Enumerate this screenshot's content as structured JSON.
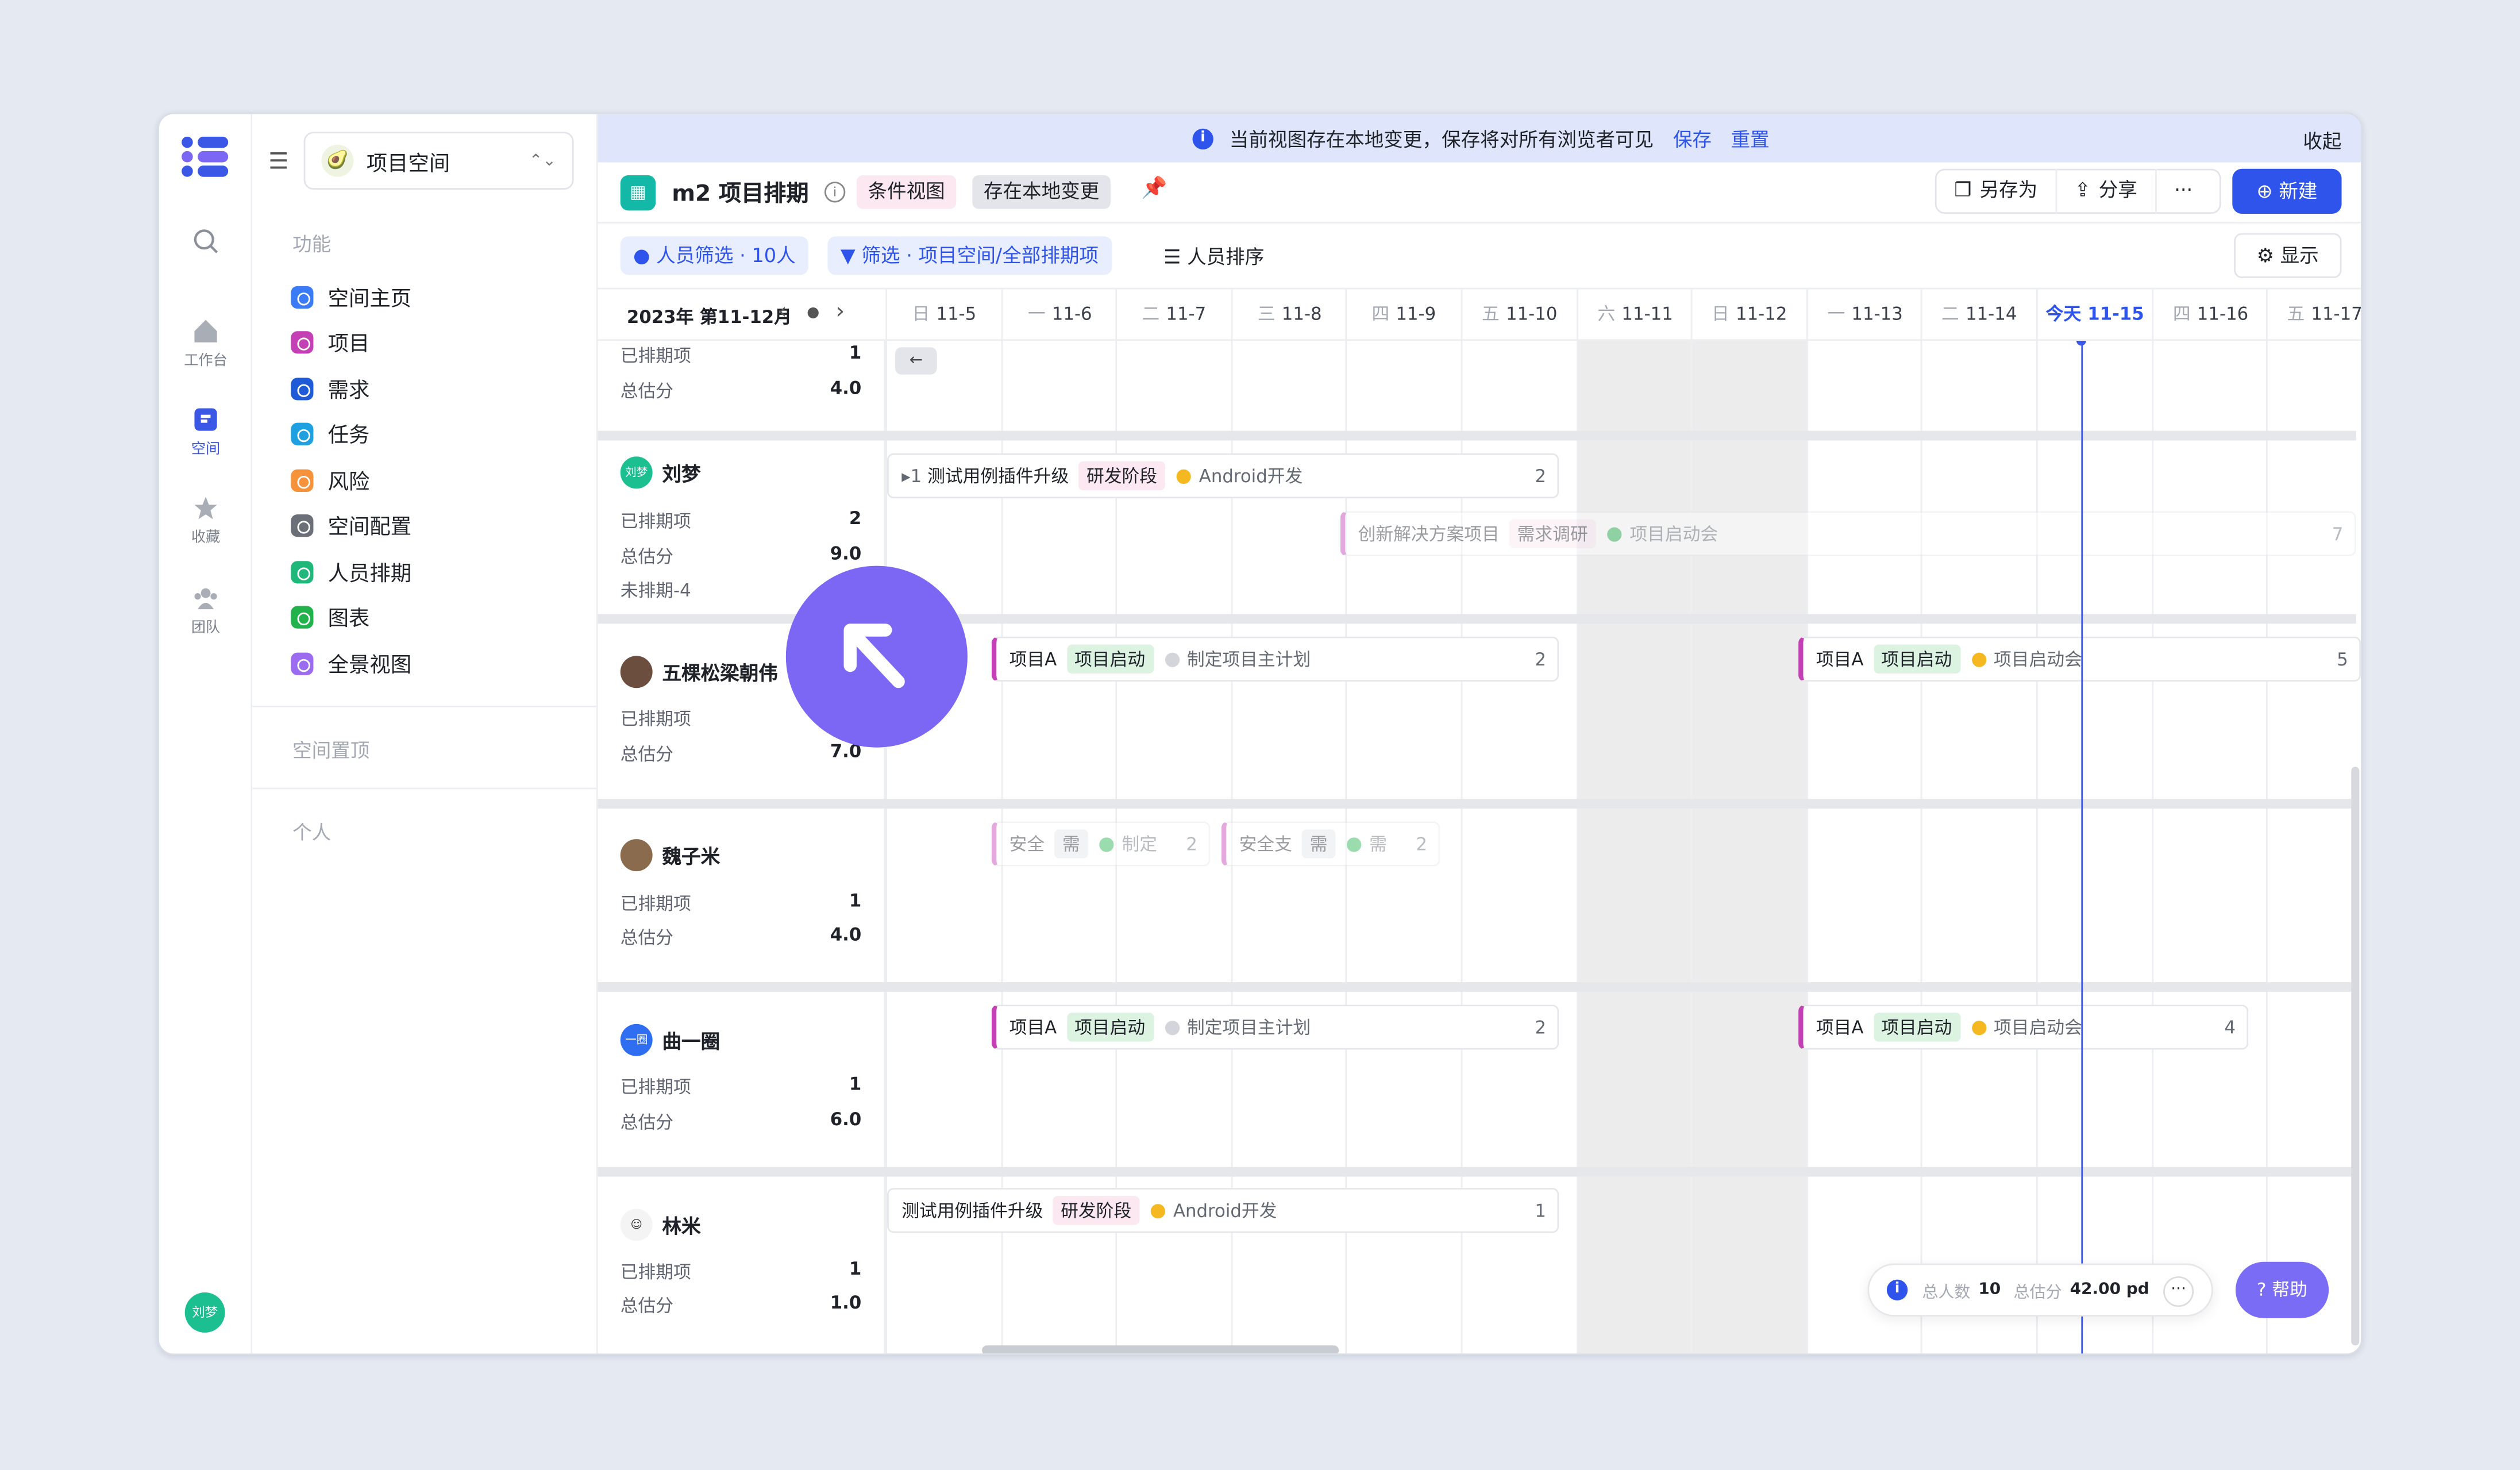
{
  "banner": {
    "text": "当前视图存在本地变更，保存将对所有浏览者可见",
    "save": "保存",
    "reset": "重置",
    "collapse": "收起"
  },
  "rail": {
    "items": [
      {
        "label": "工作台",
        "icon": "home-icon"
      },
      {
        "label": "空间",
        "icon": "space-icon"
      },
      {
        "label": "收藏",
        "icon": "star-icon"
      },
      {
        "label": "团队",
        "icon": "team-icon"
      }
    ],
    "user_avatar": "刘梦"
  },
  "sidebar": {
    "workspace": "项目空间",
    "section_features": "功能",
    "items": [
      {
        "label": "空间主页",
        "color": "#3b7bf6"
      },
      {
        "label": "项目",
        "color": "#c341b5"
      },
      {
        "label": "需求",
        "color": "#1f5bd6"
      },
      {
        "label": "任务",
        "color": "#1fa0e0"
      },
      {
        "label": "风险",
        "color": "#f5923a"
      },
      {
        "label": "空间配置",
        "color": "#6b6f78"
      },
      {
        "label": "人员排期",
        "color": "#1fb87a"
      },
      {
        "label": "图表",
        "color": "#22b24c"
      },
      {
        "label": "全景视图",
        "color": "#9b6cf0"
      }
    ],
    "section_pinned": "空间置顶",
    "section_personal": "个人"
  },
  "titlebar": {
    "title": "m2 项目排期",
    "tag_view": "条件视图",
    "tag_local": "存在本地变更",
    "save_as": "另存为",
    "share": "分享",
    "more": "···",
    "new": "新建"
  },
  "filterbar": {
    "people_filter": "人员筛选 · 10人",
    "filter": "筛选 · 项目空间/全部排期项",
    "sort": "人员排序",
    "display": "显示"
  },
  "timeline": {
    "month_label": "2023年 第11-12月",
    "today_prefix": "今天",
    "days": [
      {
        "wd": "日",
        "date": "11-5"
      },
      {
        "wd": "一",
        "date": "11-6"
      },
      {
        "wd": "二",
        "date": "11-7"
      },
      {
        "wd": "三",
        "date": "11-8"
      },
      {
        "wd": "四",
        "date": "11-9"
      },
      {
        "wd": "五",
        "date": "11-10"
      },
      {
        "wd": "六",
        "date": "11-11"
      },
      {
        "wd": "日",
        "date": "11-12"
      },
      {
        "wd": "一",
        "date": "11-13"
      },
      {
        "wd": "二",
        "date": "11-14"
      },
      {
        "wd": "",
        "date": "11-15"
      },
      {
        "wd": "四",
        "date": "11-16"
      },
      {
        "wd": "五",
        "date": "11-17"
      }
    ]
  },
  "labels": {
    "scheduled": "已排期项",
    "estimate": "总估分",
    "unscheduled": "未排期-4"
  },
  "people": [
    {
      "name": "",
      "scheduled": "1",
      "estimate": "4.0"
    },
    {
      "name": "刘梦",
      "avatar": "刘梦",
      "scheduled": "2",
      "estimate": "9.0"
    },
    {
      "name": "五棵松梁朝伟",
      "scheduled": "",
      "estimate": "7.0"
    },
    {
      "name": "魏子米",
      "scheduled": "1",
      "estimate": "4.0"
    },
    {
      "name": "曲一圈",
      "avatar": "一圈",
      "scheduled": "1",
      "estimate": "6.0"
    },
    {
      "name": "林米",
      "scheduled": "1",
      "estimate": "1.0"
    }
  ],
  "bars": {
    "b1": {
      "prefix": "▸1",
      "title": "测试用例插件升级",
      "stage": "研发阶段",
      "sub": "Android开发",
      "count": "2"
    },
    "b2": {
      "title": "创新解决方案项目",
      "stage": "需求调研",
      "sub": "项目启动会",
      "count": "7"
    },
    "b3": {
      "title": "项目A",
      "stage": "项目启动",
      "sub": "制定项目主计划",
      "count": "2"
    },
    "b4": {
      "title": "项目A",
      "stage": "项目启动",
      "sub": "项目启动会",
      "count": "5"
    },
    "b5": {
      "title": "安全",
      "stage": "需",
      "sub": "制定",
      "count": "2"
    },
    "b6": {
      "title": "安全支",
      "stage": "需",
      "sub": "需",
      "count": "2"
    },
    "b7": {
      "title": "项目A",
      "stage": "项目启动",
      "sub": "制定项目主计划",
      "count": "2"
    },
    "b8": {
      "title": "项目A",
      "stage": "项目启动",
      "sub": "项目启动会",
      "count": "4"
    },
    "b9": {
      "title": "测试用例插件升级",
      "stage": "研发阶段",
      "sub": "Android开发",
      "count": "1"
    }
  },
  "summary": {
    "people_label": "总人数",
    "people": "10",
    "est_label": "总估分",
    "est": "42.00 pd"
  },
  "help": "帮助"
}
